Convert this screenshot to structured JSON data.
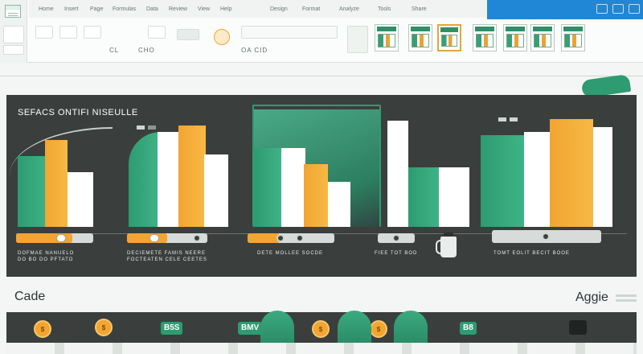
{
  "ribbon": {
    "tabs": [
      "Home",
      "Insert",
      "Page",
      "Formulas",
      "Data",
      "Review",
      "View",
      "Help",
      "Design",
      "Format",
      "Analyze",
      "Tools",
      "Share"
    ],
    "title_bar_label": "",
    "toolbar_texts": [
      "CL",
      "CHO",
      "OA CID"
    ],
    "thumbnail_count": 7
  },
  "panel": {
    "title": "SEFACS ONTIFI NISEULLE",
    "groups": [
      {
        "caption_lines": [
          "DOFMAE NANUELO",
          "DO BO DO PFTATO"
        ]
      },
      {
        "caption_lines": [
          "DECIEMETE FAMIS NEERE",
          "FOCTEATEN CELE CEETES"
        ]
      },
      {
        "caption_lines": [
          "DETE MOLLEE SOCDE"
        ]
      },
      {
        "caption_lines": [
          "FIEE TOT BOD"
        ]
      },
      {
        "caption_lines": []
      },
      {
        "caption_lines": [
          "TOMT EOLIT BECIT BOOE"
        ]
      }
    ]
  },
  "footer": {
    "left_label": "Cade",
    "right_label": "Aggie",
    "badges": [
      "B5S",
      "BMV",
      "B8"
    ],
    "coins": [
      "$",
      "$",
      "$",
      "$"
    ]
  },
  "colors": {
    "green": "#2e9b72",
    "orange": "#f2a531",
    "panel": "#3a3f3e",
    "accent_blue": "#1f87d6"
  }
}
